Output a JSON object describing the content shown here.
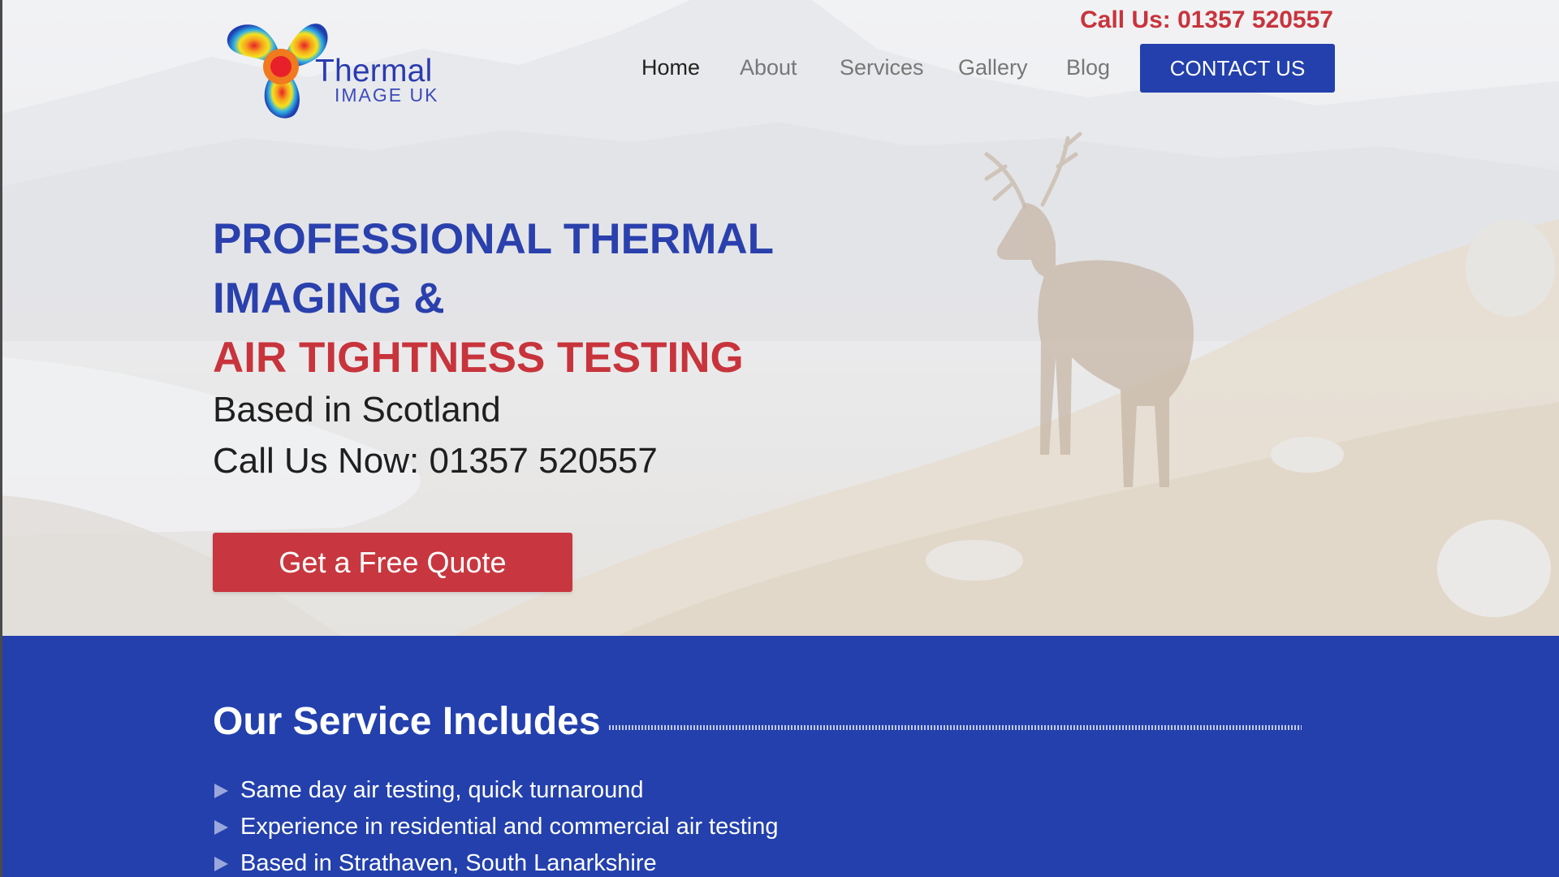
{
  "header": {
    "logo": {
      "word": "Thermal",
      "sub": "IMAGE UK"
    },
    "phone": "Call Us: 01357 520557",
    "nav": [
      {
        "label": "Home",
        "active": true
      },
      {
        "label": "About",
        "active": false
      },
      {
        "label": "Services",
        "active": false
      },
      {
        "label": "Gallery",
        "active": false
      },
      {
        "label": "Blog",
        "active": false
      }
    ],
    "contact_label": "CONTACT US"
  },
  "hero": {
    "headline_line1": "PROFESSIONAL THERMAL",
    "headline_line2": "IMAGING &",
    "headline_line3": "AIR TIGHTNESS TESTING",
    "subline1": "Based in Scotland",
    "subline2": "Call Us Now: 01357 520557",
    "cta_label": "Get a Free Quote",
    "background_image": "stag-on-hillside"
  },
  "services": {
    "title": "Our Service Includes",
    "bullet_icon": "triangle-bullet-icon",
    "items": [
      "Same day air testing, quick turnaround",
      "Experience in residential and commercial air testing",
      "Based in Strathaven, South Lanarkshire"
    ]
  },
  "colors": {
    "brand_blue": "#2340ad",
    "accent_red": "#c8343c",
    "nav_gray": "#777777",
    "text_dark": "#1f1f1f"
  }
}
